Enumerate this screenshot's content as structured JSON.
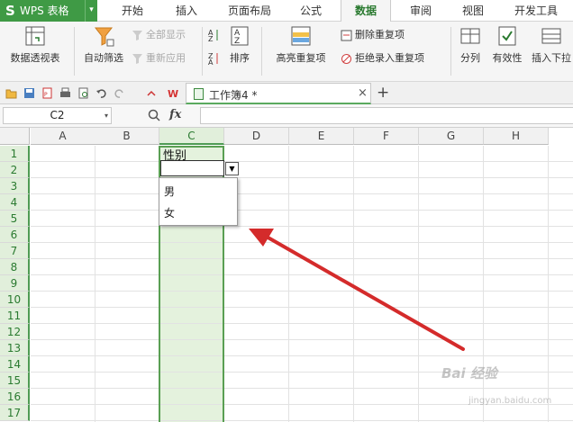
{
  "app": {
    "logo": "S",
    "name": "WPS 表格",
    "menu_arrow": "▾"
  },
  "tabs": [
    {
      "label": "开始",
      "active": false
    },
    {
      "label": "插入",
      "active": false
    },
    {
      "label": "页面布局",
      "active": false
    },
    {
      "label": "公式",
      "active": false
    },
    {
      "label": "数据",
      "active": true
    },
    {
      "label": "审阅",
      "active": false
    },
    {
      "label": "视图",
      "active": false
    },
    {
      "label": "开发工具",
      "active": false
    }
  ],
  "ribbon": {
    "pivot_table": "数据透视表",
    "auto_filter": "自动筛选",
    "show_all": "全部显示",
    "reapply": "重新应用",
    "sort": "排序",
    "highlight_duplicates": "高亮重复项",
    "remove_duplicates": "删除重复项",
    "reject_duplicates": "拒绝录入重复项",
    "split": "分列",
    "validity": "有效性",
    "insert_dropdown": "插入下拉"
  },
  "document": {
    "tab_title": "工作簿4 *",
    "close": "×",
    "new_tab": "+"
  },
  "formula_bar": {
    "name_box": "C2",
    "fx": "fx",
    "formula": ""
  },
  "grid": {
    "columns": [
      "A",
      "B",
      "C",
      "D",
      "E",
      "F",
      "G",
      "H"
    ],
    "selected_column": "C",
    "rows": [
      "1",
      "2",
      "3",
      "4",
      "5",
      "6",
      "7",
      "8",
      "9",
      "10",
      "11",
      "12",
      "13",
      "14",
      "15",
      "16",
      "17"
    ],
    "cells": {
      "C1": "性别",
      "C2": ""
    }
  },
  "dropdown": {
    "items": [
      "男",
      "女"
    ]
  },
  "watermark": {
    "text": "Bai 经验",
    "sub": "jingyan.baidu.com"
  },
  "colors": {
    "brand": "#3f9a45",
    "selection": "#e4f2dd",
    "arrow": "#d42b2b"
  }
}
